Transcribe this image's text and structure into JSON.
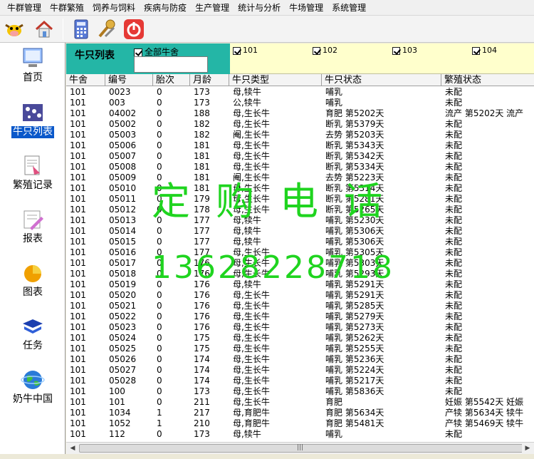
{
  "menu": [
    "牛群管理",
    "牛群繁殖",
    "饲养与饲料",
    "疾病与防疫",
    "生产管理",
    "统计与分析",
    "牛场管理",
    "系统管理"
  ],
  "toolbar": {
    "icons": [
      "cow-icon",
      "home-icon",
      "calculator-icon",
      "tools-icon",
      "power-icon"
    ]
  },
  "sidebar": [
    {
      "label": "首页",
      "icon": "computer-icon"
    },
    {
      "label": "牛只列表",
      "icon": "cow-list-icon",
      "active": true
    },
    {
      "label": "繁殖记录",
      "icon": "breeding-record-icon"
    },
    {
      "label": "报表",
      "icon": "report-icon"
    },
    {
      "label": "图表",
      "icon": "chart-icon"
    },
    {
      "label": "任务",
      "icon": "task-book-icon"
    },
    {
      "label": "奶牛中国",
      "icon": "globe-icon"
    }
  ],
  "header": {
    "title": "牛只列表",
    "all_label": "全部牛舍",
    "all_value": "",
    "pens": [
      "101",
      "102",
      "103",
      "104"
    ]
  },
  "table": {
    "columns": [
      "牛舍",
      "编号",
      "胎次",
      "月龄",
      "牛只类型",
      "牛只状态",
      "繁殖状态"
    ],
    "rows": [
      [
        "101",
        "0023",
        "0",
        "173",
        "母,犊牛",
        "哺乳",
        "未配"
      ],
      [
        "101",
        "003",
        "0",
        "173",
        "公,犊牛",
        "哺乳",
        "未配"
      ],
      [
        "101",
        "04002",
        "0",
        "188",
        "母,生长牛",
        "育肥 第5202天",
        "流产 第5202天  流产"
      ],
      [
        "101",
        "05002",
        "0",
        "182",
        "母,生长牛",
        "断乳 第5379天",
        "未配"
      ],
      [
        "101",
        "05003",
        "0",
        "182",
        "阉,生长牛",
        "去势 第5203天",
        "未配"
      ],
      [
        "101",
        "05006",
        "0",
        "181",
        "母,生长牛",
        "断乳 第5343天",
        "未配"
      ],
      [
        "101",
        "05007",
        "0",
        "181",
        "母,生长牛",
        "断乳 第5342天",
        "未配"
      ],
      [
        "101",
        "05008",
        "0",
        "181",
        "母,生长牛",
        "断乳 第5334天",
        "未配"
      ],
      [
        "101",
        "05009",
        "0",
        "181",
        "阉,生长牛",
        "去势 第5223天",
        "未配"
      ],
      [
        "101",
        "05010",
        "0",
        "181",
        "母,生长牛",
        "断乳 第5314天",
        "未配"
      ],
      [
        "101",
        "05011",
        "0",
        "179",
        "母,生长牛",
        "断乳 第5281天",
        "未配"
      ],
      [
        "101",
        "05012",
        "0",
        "178",
        "母,生长牛",
        "断乳 第5265天",
        "未配"
      ],
      [
        "101",
        "05013",
        "0",
        "177",
        "母,犊牛",
        "哺乳 第5230天",
        "未配"
      ],
      [
        "101",
        "05014",
        "0",
        "177",
        "母,犊牛",
        "哺乳 第5306天",
        "未配"
      ],
      [
        "101",
        "05015",
        "0",
        "177",
        "母,犊牛",
        "哺乳 第5306天",
        "未配"
      ],
      [
        "101",
        "05016",
        "0",
        "177",
        "母,生长牛",
        "哺乳 第5305天",
        "未配"
      ],
      [
        "101",
        "05017",
        "0",
        "176",
        "母,生长牛",
        "哺乳 第5303天",
        "未配"
      ],
      [
        "101",
        "05018",
        "0",
        "176",
        "母,生长牛",
        "哺乳 第5293天",
        "未配"
      ],
      [
        "101",
        "05019",
        "0",
        "176",
        "母,犊牛",
        "哺乳 第5291天",
        "未配"
      ],
      [
        "101",
        "05020",
        "0",
        "176",
        "母,生长牛",
        "哺乳 第5291天",
        "未配"
      ],
      [
        "101",
        "05021",
        "0",
        "176",
        "母,生长牛",
        "哺乳 第5285天",
        "未配"
      ],
      [
        "101",
        "05022",
        "0",
        "176",
        "母,生长牛",
        "哺乳 第5279天",
        "未配"
      ],
      [
        "101",
        "05023",
        "0",
        "176",
        "母,生长牛",
        "哺乳 第5273天",
        "未配"
      ],
      [
        "101",
        "05024",
        "0",
        "175",
        "母,生长牛",
        "哺乳 第5262天",
        "未配"
      ],
      [
        "101",
        "05025",
        "0",
        "175",
        "母,生长牛",
        "哺乳 第5255天",
        "未配"
      ],
      [
        "101",
        "05026",
        "0",
        "174",
        "母,生长牛",
        "哺乳 第5236天",
        "未配"
      ],
      [
        "101",
        "05027",
        "0",
        "174",
        "母,生长牛",
        "哺乳 第5224天",
        "未配"
      ],
      [
        "101",
        "05028",
        "0",
        "174",
        "母,生长牛",
        "哺乳 第5217天",
        "未配"
      ],
      [
        "101",
        "100",
        "0",
        "173",
        "母,生长牛",
        "哺乳 第5836天",
        "未配"
      ],
      [
        "101",
        "101",
        "0",
        "211",
        "母,生长牛",
        "育肥",
        "妊娠 第5542天  妊娠"
      ],
      [
        "101",
        "1034",
        "1",
        "217",
        "母,育肥牛",
        "育肥 第5634天",
        "产犊 第5634天  犊牛"
      ],
      [
        "101",
        "1052",
        "1",
        "210",
        "母,育肥牛",
        "育肥 第5481天",
        "产犊 第5469天  犊牛"
      ],
      [
        "101",
        "112",
        "0",
        "173",
        "母,犊牛",
        "哺乳",
        "未配"
      ]
    ]
  },
  "watermark": {
    "line1": "定购电话",
    "line2": "13628228718"
  },
  "scrollbar": {
    "grip": "|||"
  },
  "colors": {
    "header_teal": "#24b6a6",
    "header_yellow": "#ffffcc",
    "watermark": "#1fd41f",
    "active": "#0a58ca"
  }
}
